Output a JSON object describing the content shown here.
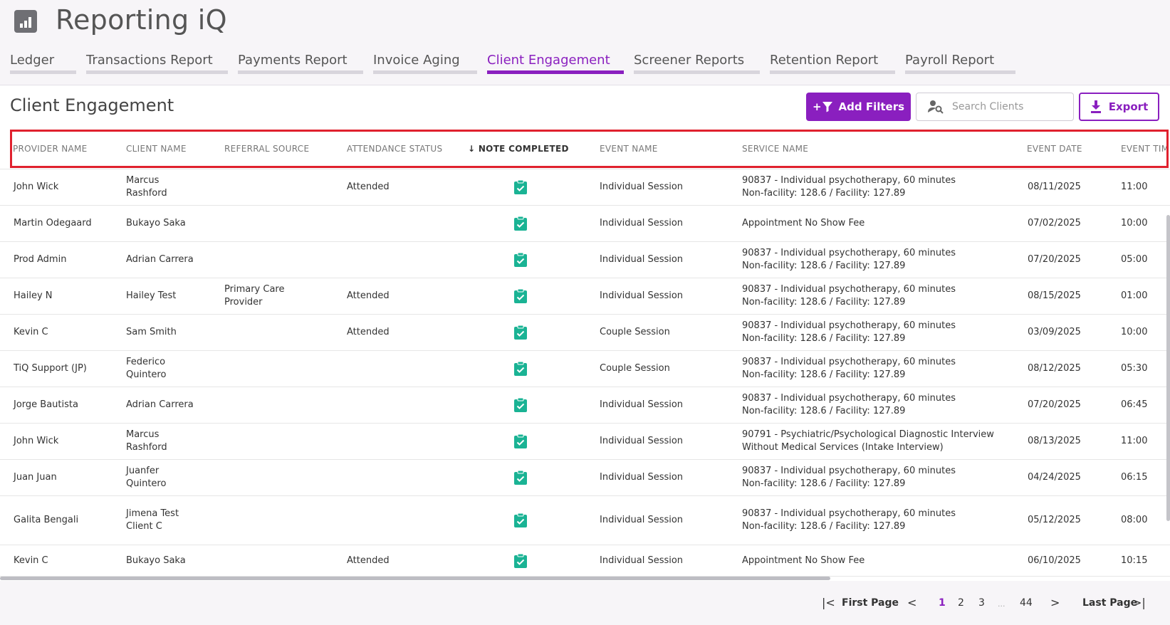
{
  "app": {
    "title": "Reporting iQ",
    "logo_icon": "bar-chart-icon"
  },
  "tabs": [
    {
      "label": "Ledger",
      "active": false
    },
    {
      "label": "Transactions Report",
      "active": false
    },
    {
      "label": "Payments Report",
      "active": false
    },
    {
      "label": "Invoice Aging",
      "active": false
    },
    {
      "label": "Client Engagement",
      "active": true
    },
    {
      "label": "Screener Reports",
      "active": false
    },
    {
      "label": "Retention Report",
      "active": false
    },
    {
      "label": "Payroll Report",
      "active": false
    }
  ],
  "toolbar": {
    "page_title": "Client Engagement",
    "filters_label": "Add Filters",
    "filters_prefix": "+",
    "search_placeholder": "Search Clients",
    "export_label": "Export"
  },
  "table": {
    "columns": [
      "PROVIDER NAME",
      "CLIENT NAME",
      "REFERRAL SOURCE",
      "ATTENDANCE STATUS",
      "NOTE COMPLETED",
      "EVENT NAME",
      "SERVICE NAME",
      "EVENT DATE",
      "EVENT TIM"
    ],
    "sort_arrow": "↓",
    "rows": [
      {
        "provider": "John Wick",
        "client": "Marcus Rashford",
        "referral": "",
        "attendance": "Attended",
        "event": "Individual Session",
        "service1": "90837 - Individual psychotherapy, 60 minutes",
        "service2": "Non-facility: 128.6 / Facility: 127.89",
        "date": "08/11/2025",
        "time": "11:00"
      },
      {
        "provider": "Martin Odegaard",
        "client": "Bukayo Saka",
        "referral": "",
        "attendance": "",
        "event": "Individual Session",
        "service1": "Appointment No Show Fee",
        "service2": "",
        "date": "07/02/2025",
        "time": "10:00"
      },
      {
        "provider": "Prod Admin",
        "client": "Adrian Carrera",
        "referral": "",
        "attendance": "",
        "event": "Individual Session",
        "service1": "90837 - Individual psychotherapy, 60 minutes",
        "service2": "Non-facility: 128.6 / Facility: 127.89",
        "date": "07/20/2025",
        "time": "05:00"
      },
      {
        "provider": "Hailey N",
        "client": "Hailey Test",
        "referral": "Primary Care Provider",
        "attendance": "Attended",
        "event": "Individual Session",
        "service1": "90837 - Individual psychotherapy, 60 minutes",
        "service2": "Non-facility: 128.6 / Facility: 127.89",
        "date": "08/15/2025",
        "time": "01:00"
      },
      {
        "provider": "Kevin C",
        "client": "Sam Smith",
        "referral": "",
        "attendance": "Attended",
        "event": "Couple Session",
        "service1": "90837 - Individual psychotherapy, 60 minutes",
        "service2": "Non-facility: 128.6 / Facility: 127.89",
        "date": "03/09/2025",
        "time": "10:00"
      },
      {
        "provider": "TiQ Support (JP)",
        "client": "Federico Quintero",
        "referral": "",
        "attendance": "",
        "event": "Couple Session",
        "service1": "90837 - Individual psychotherapy, 60 minutes",
        "service2": "Non-facility: 128.6 / Facility: 127.89",
        "date": "08/12/2025",
        "time": "05:30"
      },
      {
        "provider": "Jorge Bautista",
        "client": "Adrian Carrera",
        "referral": "",
        "attendance": "",
        "event": "Individual Session",
        "service1": "90837 - Individual psychotherapy, 60 minutes",
        "service2": "Non-facility: 128.6 / Facility: 127.89",
        "date": "07/20/2025",
        "time": "06:45"
      },
      {
        "provider": "John Wick",
        "client": "Marcus Rashford",
        "referral": "",
        "attendance": "",
        "event": "Individual Session",
        "service1": "90791 - Psychiatric/Psychological Diagnostic Interview",
        "service2": "Without Medical Services (Intake Interview)",
        "date": "08/13/2025",
        "time": "11:00"
      },
      {
        "provider": "Juan Juan",
        "client": "Juanfer Quintero",
        "referral": "",
        "attendance": "",
        "event": "Individual Session",
        "service1": "90837 - Individual psychotherapy, 60 minutes",
        "service2": "Non-facility: 128.6 / Facility: 127.89",
        "date": "04/24/2025",
        "time": "06:15"
      },
      {
        "provider": "Galita Bengali",
        "client": "Jimena Test Client C",
        "referral": "",
        "attendance": "",
        "event": "Individual Session",
        "service1": "90837 - Individual psychotherapy, 60 minutes",
        "service2": "Non-facility: 128.6 / Facility: 127.89",
        "date": "05/12/2025",
        "time": "08:00"
      },
      {
        "provider": "Kevin C",
        "client": "Bukayo Saka",
        "referral": "",
        "attendance": "Attended",
        "event": "Individual Session",
        "service1": "Appointment No Show Fee",
        "service2": "",
        "date": "06/10/2025",
        "time": "10:15"
      }
    ]
  },
  "pagination": {
    "first_label": "First Page",
    "last_label": "Last Page",
    "pages": [
      "1",
      "2",
      "3"
    ],
    "ellipsis": "...",
    "last_page": "44",
    "current": "1"
  },
  "colors": {
    "accent": "#8a1fbf",
    "check": "#1ab394",
    "highlight": "#e0212e"
  }
}
